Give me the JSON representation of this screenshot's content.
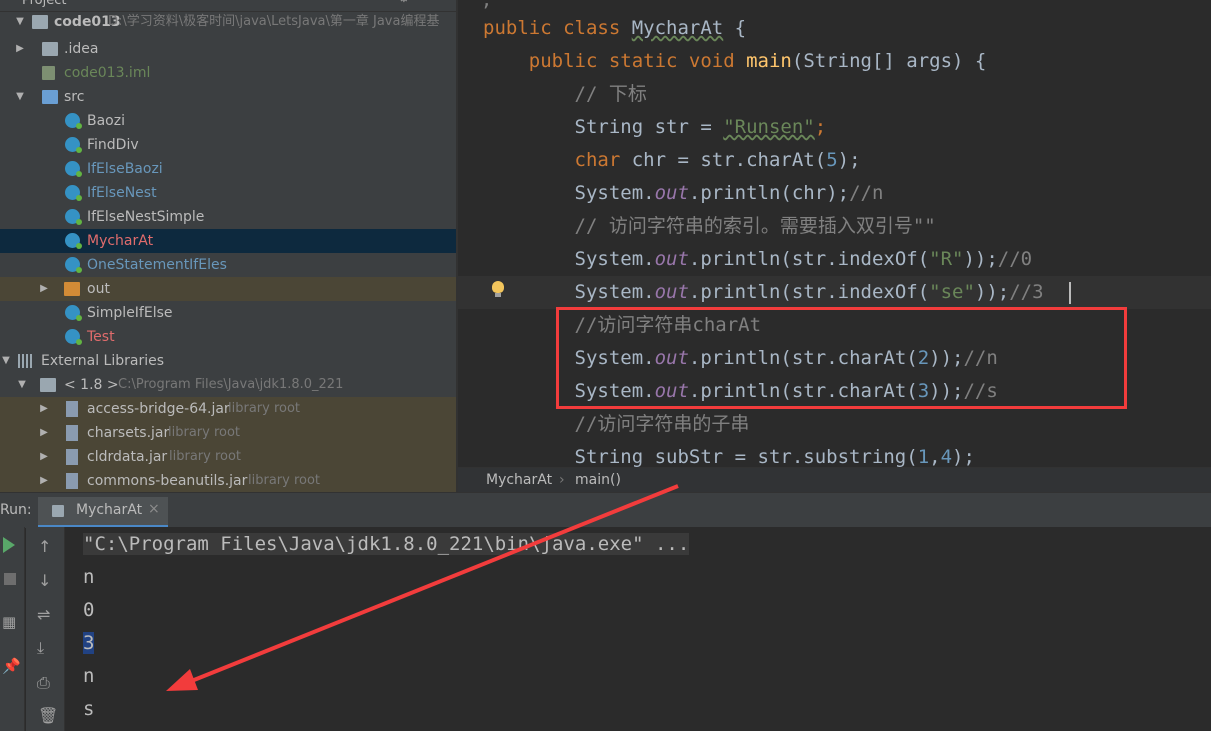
{
  "project": {
    "header_title": "Project",
    "tree": [
      {
        "name": "code013",
        "path": "D:\\学习资料\\极客时间\\java\\LetsJava\\第一章 Java编程基"
      },
      {
        "name": ".idea"
      },
      {
        "name": "code013.iml"
      },
      {
        "name": "src"
      },
      {
        "name": "Baozi"
      },
      {
        "name": "FindDiv"
      },
      {
        "name": "IfElseBaozi"
      },
      {
        "name": "IfElseNest"
      },
      {
        "name": "IfElseNestSimple"
      },
      {
        "name": "MycharAt"
      },
      {
        "name": "OneStatementIfEles"
      },
      {
        "name": "out"
      },
      {
        "name": "SimpleIfElse"
      },
      {
        "name": "Test"
      },
      {
        "name": "External Libraries"
      },
      {
        "name": "< 1.8 >",
        "path": "C:\\Program Files\\Java\\jdk1.8.0_221"
      },
      {
        "name": "access-bridge-64.jar",
        "tag": "library root"
      },
      {
        "name": "charsets.jar",
        "tag": "library root"
      },
      {
        "name": "cldrdata.jar",
        "tag": "library root"
      },
      {
        "name": "commons-beanutils.jar",
        "tag": "library root"
      }
    ]
  },
  "editor": {
    "lines": [
      {
        "a": "public class ",
        "b": "MycharAt",
        "c": " {"
      },
      {
        "a": "    public static void ",
        "b": "main",
        "c": "(String[] args) {"
      },
      {
        "a": "        // 下标"
      },
      {
        "a": "        String str = ",
        "b": "\"Runsen\"",
        "c": ";"
      },
      {
        "a": "        char ",
        "b": "chr = str.charAt(",
        "c": "5",
        "d": ");"
      },
      {
        "a": "        System.",
        "b": "out",
        "c": ".println(chr);",
        "d": "//n"
      },
      {
        "a": "        // 访问字符串的索引。需要插入双引号\"\""
      },
      {
        "a": "        System.",
        "b": "out",
        "c": ".println(str.indexOf(",
        "d": "\"R\"",
        "e": "));",
        "f": "//0"
      },
      {
        "a": "        System.",
        "b": "out",
        "c": ".println(str.indexOf(",
        "d": "\"se\"",
        "e": "));",
        "f": "//3"
      },
      {
        "a": "        //访问字符串charAt"
      },
      {
        "a": "        System.",
        "b": "out",
        "c": ".println(str.charAt(",
        "d": "2",
        "e": "));",
        "f": "//n"
      },
      {
        "a": "        System.",
        "b": "out",
        "c": ".println(str.charAt(",
        "d": "3",
        "e": "));",
        "f": "//s"
      },
      {
        "a": "        //访问字符串的子串"
      },
      {
        "a": "        String subStr = str.substring(",
        "b": "1",
        "c": ",",
        "d": "4",
        "e": ");"
      }
    ]
  },
  "breadcrumb": {
    "class": "MycharAt",
    "method": "main()",
    "separator": "›"
  },
  "run": {
    "label": "Run:",
    "tab_name": "MycharAt",
    "tab_close": "×",
    "command": "\"C:\\Program Files\\Java\\jdk1.8.0_221\\bin\\java.exe\" ...",
    "output": [
      "n",
      "0",
      "3",
      "n",
      "s"
    ]
  },
  "colors": {
    "highlight_box": "#f23c3c",
    "arrow": "#f23c3c"
  }
}
